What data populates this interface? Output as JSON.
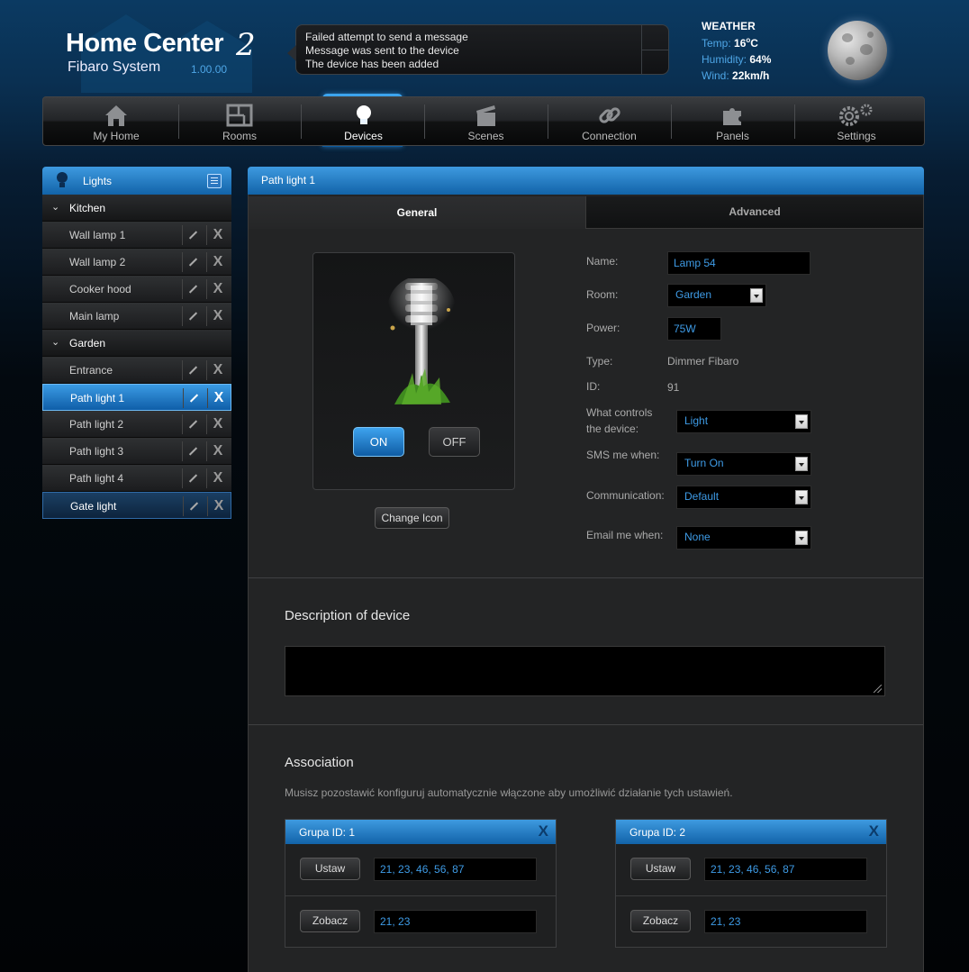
{
  "app": {
    "title": "Home Center",
    "title_number": "2",
    "subtitle": "Fibaro System",
    "version": "1.00.00"
  },
  "messages": [
    "Failed attempt to send a message",
    "Message was sent to the device",
    "The device has been added"
  ],
  "weather": {
    "title": "WEATHER",
    "temp_label": "Temp:",
    "temp_value": "16",
    "temp_unit": "C",
    "humidity_label": "Humidity:",
    "humidity_value": "64%",
    "wind_label": "Wind:",
    "wind_value": "22km/h"
  },
  "nav": {
    "items": [
      {
        "label": "My Home",
        "icon": "house-icon"
      },
      {
        "label": "Rooms",
        "icon": "floorplan-icon"
      },
      {
        "label": "Devices",
        "icon": "lightbulb-icon",
        "active": true
      },
      {
        "label": "Scenes",
        "icon": "clapperboard-icon"
      },
      {
        "label": "Connection",
        "icon": "chain-link-icon"
      },
      {
        "label": "Panels",
        "icon": "puzzle-icon"
      },
      {
        "label": "Settings",
        "icon": "gears-icon"
      }
    ]
  },
  "sidebar": {
    "title": "Lights",
    "categories": [
      {
        "name": "Kitchen",
        "devices": [
          "Wall lamp 1",
          "Wall lamp 2",
          "Cooker hood",
          "Main lamp"
        ]
      },
      {
        "name": "Garden",
        "devices": [
          "Entrance",
          "Path light 1",
          "Path light 2",
          "Path light 3",
          "Path light 4",
          "Gate light"
        ]
      }
    ],
    "selected": "Path light 1",
    "highlighted": "Gate light",
    "delete_glyph": "X"
  },
  "device": {
    "header": "Path light 1",
    "tabs": [
      "General",
      "Advanced"
    ],
    "active_tab": "General",
    "on_label": "ON",
    "off_label": "OFF",
    "change_icon_label": "Change Icon",
    "fields": {
      "name_label": "Name:",
      "name_value": "Lamp 54",
      "room_label": "Room:",
      "room_value": "Garden",
      "power_label": "Power:",
      "power_value": "75W",
      "type_label": "Type:",
      "type_value": "Dimmer Fibaro",
      "id_label": "ID:",
      "id_value": "91",
      "controls_label_1": "What controls",
      "controls_label_2": "the device:",
      "controls_value": "Light",
      "sms_label": "SMS me when:",
      "sms_value": "Turn On",
      "communication_label": "Communication:",
      "communication_value": "Default",
      "email_label": "Email me when:",
      "email_value": "None"
    }
  },
  "description": {
    "title": "Description of device",
    "value": ""
  },
  "association": {
    "title": "Association",
    "note": "Musisz pozostawić konfiguruj automatycznie włączone aby umożliwić działanie tych ustawień.",
    "groups": [
      {
        "title": "Grupa ID: 1",
        "close": "X",
        "set_label": "Ustaw",
        "set_value": "21, 23, 46, 56, 87",
        "view_label": "Zobacz",
        "view_value": "21, 23"
      },
      {
        "title": "Grupa ID: 2",
        "close": "X",
        "set_label": "Ustaw",
        "set_value": "21, 23, 46, 56, 87",
        "view_label": "Zobacz",
        "view_value": "21, 23"
      }
    ]
  },
  "colors": {
    "accent_blue": "#1e7fcc",
    "value_text": "#3e9be6",
    "panel_bg": "#232425"
  }
}
